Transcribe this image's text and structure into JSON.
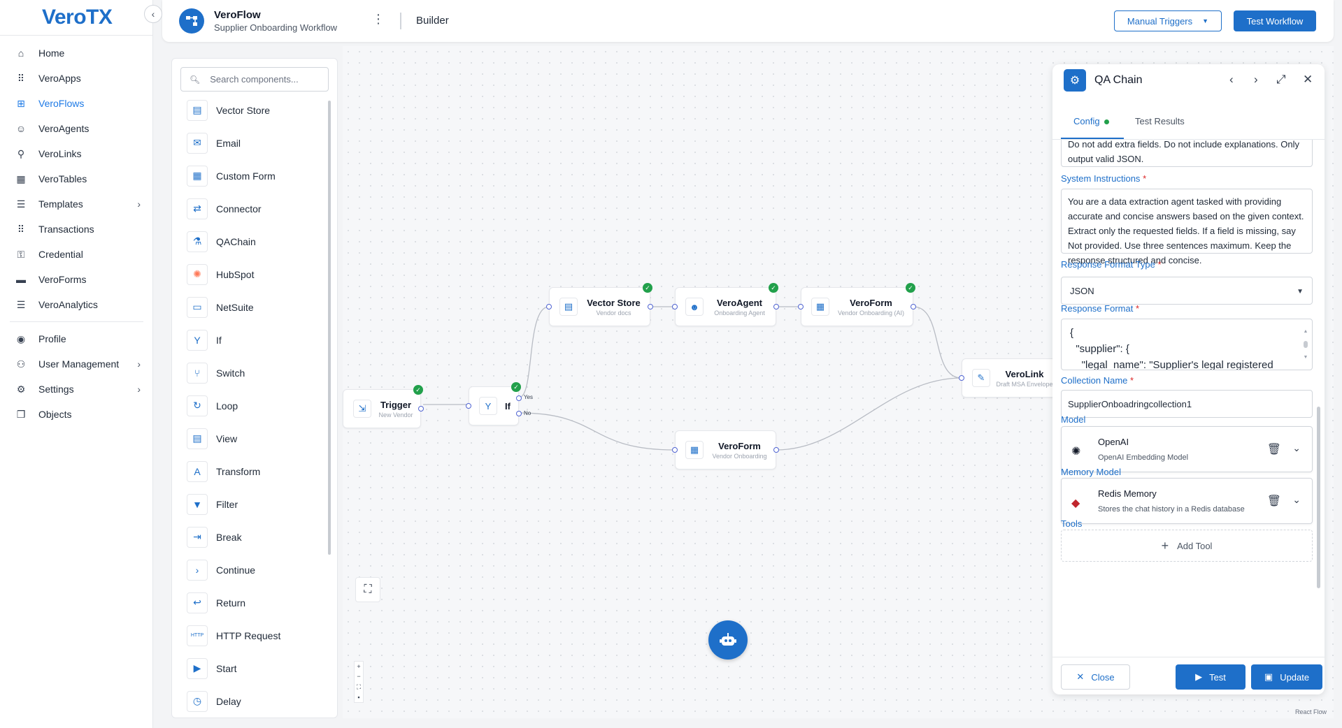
{
  "brand": {
    "logo": "VeroTX"
  },
  "sidebar": {
    "items": [
      {
        "label": "Home",
        "icon": "home-icon",
        "glyph": "⌂"
      },
      {
        "label": "VeroApps",
        "icon": "grid-icon",
        "glyph": "⠿"
      },
      {
        "label": "VeroFlows",
        "icon": "flow-icon",
        "glyph": "⊞"
      },
      {
        "label": "VeroAgents",
        "icon": "agent-icon",
        "glyph": "☺"
      },
      {
        "label": "VeroLinks",
        "icon": "link-icon",
        "glyph": "⚲"
      },
      {
        "label": "VeroTables",
        "icon": "table-icon",
        "glyph": "▦"
      },
      {
        "label": "Templates",
        "icon": "list-icon",
        "glyph": "☰"
      },
      {
        "label": "Transactions",
        "icon": "grid-icon",
        "glyph": "⠿"
      },
      {
        "label": "Credential",
        "icon": "key-icon",
        "glyph": "⚿"
      },
      {
        "label": "VeroForms",
        "icon": "folder-icon",
        "glyph": "▬"
      },
      {
        "label": "VeroAnalytics",
        "icon": "list-icon",
        "glyph": "☰"
      }
    ],
    "bottom_items": [
      {
        "label": "Profile",
        "icon": "user-circle-icon",
        "glyph": "◉"
      },
      {
        "label": "User Management",
        "icon": "users-icon",
        "glyph": "⚇"
      },
      {
        "label": "Settings",
        "icon": "gear-icon",
        "glyph": "⚙"
      },
      {
        "label": "Objects",
        "icon": "cube-icon",
        "glyph": "❒"
      }
    ]
  },
  "header": {
    "title": "VeroFlow",
    "subtitle": "Supplier Onboarding Workflow",
    "section": "Builder",
    "manual_triggers": "Manual Triggers",
    "test_workflow": "Test Workflow"
  },
  "components": {
    "search_placeholder": "Search components...",
    "items": [
      {
        "label": "Vector Store",
        "icon": "vector-store-icon",
        "glyph": "▤"
      },
      {
        "label": "Email",
        "icon": "email-icon",
        "glyph": "✉"
      },
      {
        "label": "Custom Form",
        "icon": "form-icon",
        "glyph": "▦"
      },
      {
        "label": "Connector",
        "icon": "connector-icon",
        "glyph": "⇄"
      },
      {
        "label": "QAChain",
        "icon": "qachain-icon",
        "glyph": "⚗"
      },
      {
        "label": "HubSpot",
        "icon": "hubspot-icon",
        "glyph": "✺"
      },
      {
        "label": "NetSuite",
        "icon": "netsuite-icon",
        "glyph": "▭"
      },
      {
        "label": "If",
        "icon": "branch-icon",
        "glyph": "Y"
      },
      {
        "label": "Switch",
        "icon": "switch-icon",
        "glyph": "⑂"
      },
      {
        "label": "Loop",
        "icon": "loop-icon",
        "glyph": "↻"
      },
      {
        "label": "View",
        "icon": "view-icon",
        "glyph": "▤"
      },
      {
        "label": "Transform",
        "icon": "transform-icon",
        "glyph": "A"
      },
      {
        "label": "Filter",
        "icon": "filter-icon",
        "glyph": "▼"
      },
      {
        "label": "Break",
        "icon": "break-icon",
        "glyph": "⇥"
      },
      {
        "label": "Continue",
        "icon": "continue-icon",
        "glyph": "›"
      },
      {
        "label": "Return",
        "icon": "return-icon",
        "glyph": "↩"
      },
      {
        "label": "HTTP Request",
        "icon": "http-icon",
        "glyph": "HTTP"
      },
      {
        "label": "Start",
        "icon": "start-icon",
        "glyph": "▶"
      },
      {
        "label": "Delay",
        "icon": "delay-icon",
        "glyph": "◷"
      }
    ]
  },
  "flow": {
    "nodes": {
      "trigger": {
        "title": "Trigger",
        "sub": "New Vendor"
      },
      "if": {
        "title": "If",
        "yes": "Yes",
        "no": "No"
      },
      "vector_store": {
        "title": "Vector Store",
        "sub": "Vendor docs"
      },
      "vero_agent": {
        "title": "VeroAgent",
        "sub": "Onboarding Agent"
      },
      "vero_form_ai": {
        "title": "VeroForm",
        "sub": "Vendor Onboarding (AI)"
      },
      "vero_link": {
        "title": "VeroLink",
        "sub": "Draft MSA Envelope"
      },
      "vero_form": {
        "title": "VeroForm",
        "sub": "Vendor Onboarding"
      }
    },
    "attribution": "React Flow"
  },
  "config": {
    "title": "QA Chain",
    "tabs": {
      "config": "Config",
      "results": "Test Results"
    },
    "prev_text": "Do not add extra fields. Do not include explanations. Only output valid JSON.",
    "system_instructions_label": "System Instructions",
    "system_instructions": "You are a data extraction agent tasked with providing accurate and concise answers based on the given context. Extract only the requested fields. If a field is missing, say Not provided. Use three sentences maximum. Keep the response structured and concise.",
    "response_format_type_label": "Response Format Type",
    "response_format_type": "JSON",
    "response_format_label": "Response Format",
    "response_format": "{\n  \"supplier\": {\n    \"legal_name\": \"Supplier's legal registered\n        official company name\",",
    "collection_name_label": "Collection Name",
    "collection_name": "SupplierOnboadringcollection1",
    "model_label": "Model",
    "model": {
      "name": "OpenAI",
      "desc": "OpenAI Embedding Model"
    },
    "memory_label": "Memory Model",
    "memory": {
      "name": "Redis Memory",
      "desc": "Stores the chat history in a Redis database"
    },
    "tools_label": "Tools",
    "add_tool": "Add Tool",
    "required_mark": "*",
    "buttons": {
      "close": "Close",
      "test": "Test",
      "update": "Update"
    }
  },
  "colors": {
    "primary": "#1e6fc9",
    "success": "#22a04b",
    "edge": "#b8bcc4",
    "handle": "#4f63d2"
  }
}
